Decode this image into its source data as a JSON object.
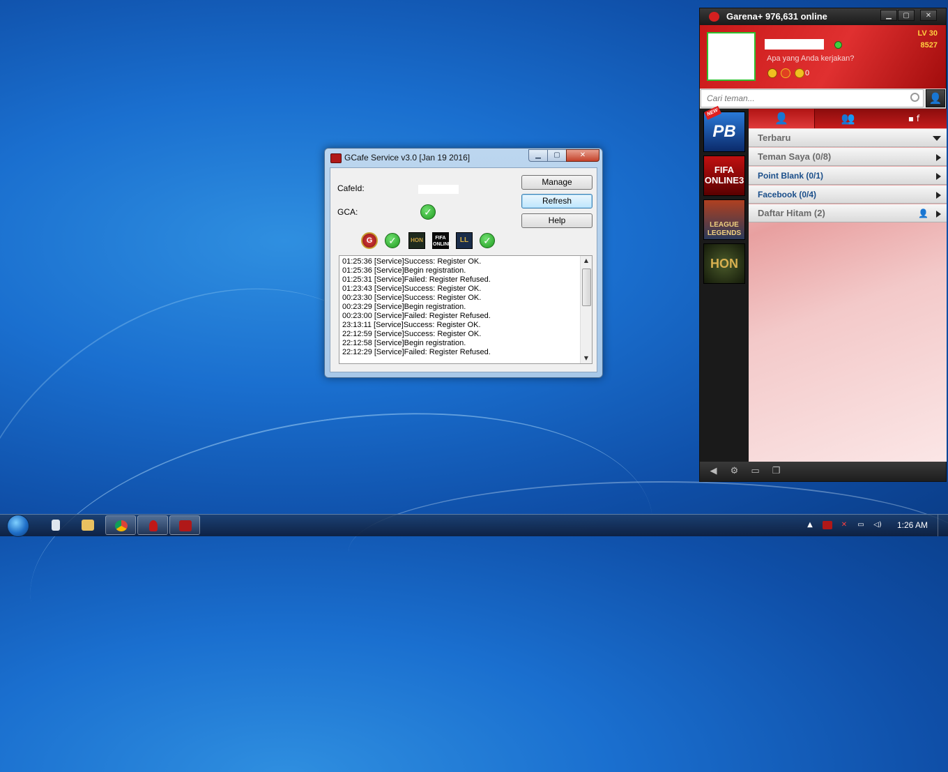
{
  "gcafe": {
    "title": "GCafe Service v3.0 [Jan 19 2016]",
    "cafeid_label": "CafeId:",
    "gca_label": "GCA:",
    "buttons": {
      "manage": "Manage",
      "refresh": "Refresh",
      "help": "Help"
    },
    "game_icons": {
      "hon": "HON",
      "fifa": "FIFA ONLINE",
      "lol": "LL"
    },
    "log_lines": [
      "01:25:36 [Service]Success: Register OK.",
      "01:25:36 [Service]Begin registration.",
      "01:25:31 [Service]Failed: Register Refused.",
      "01:23:43 [Service]Success: Register OK.",
      "00:23:30 [Service]Success: Register OK.",
      "00:23:29 [Service]Begin registration.",
      "00:23:00 [Service]Failed: Register Refused.",
      "23:13:11 [Service]Success: Register OK.",
      "22:12:59 [Service]Success: Register OK.",
      "22:12:58 [Service]Begin registration.",
      "22:12:29 [Service]Failed: Register Refused."
    ]
  },
  "garena": {
    "title": "Garena+ 976,631 online",
    "level": "LV 30",
    "points": "8527",
    "status_prompt": "Apa yang Anda kerjakan?",
    "coins": "0",
    "search_placeholder": "Cari teman...",
    "games": {
      "pb": "PB",
      "fifa": "FIFA ONLINE3",
      "lol": "LEAGUE LEGENDS",
      "hon": "HON",
      "new_badge": "NEW"
    },
    "groups": [
      {
        "label": "Terbaru"
      },
      {
        "label": "Teman Saya (0/8)"
      },
      {
        "label": "Point Blank (0/1)"
      },
      {
        "label": "Facebook (0/4)"
      },
      {
        "label": "Daftar Hitam (2)"
      }
    ]
  },
  "taskbar": {
    "clock": "1:26 AM"
  },
  "colors": {
    "garena_red": "#d42020",
    "check_green": "#1f9a1f",
    "gcafe_frame": "#a8c8e8"
  }
}
